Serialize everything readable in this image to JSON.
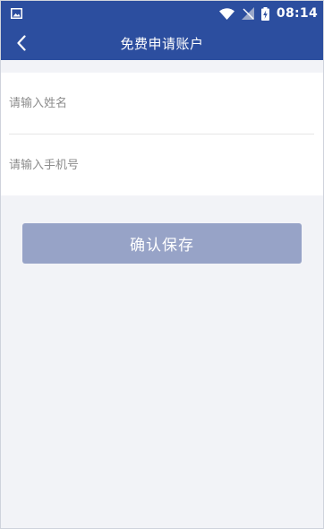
{
  "status_bar": {
    "time": "08:14",
    "icons": [
      "image-icon",
      "wifi-icon",
      "no-signal-icon",
      "battery-charging-icon"
    ]
  },
  "app_bar": {
    "back_icon": "chevron-left-icon",
    "title": "免费申请账户"
  },
  "form": {
    "name_placeholder": "请输入姓名",
    "name_value": "",
    "phone_placeholder": "请输入手机号",
    "phone_value": ""
  },
  "actions": {
    "confirm_label": "确认保存"
  },
  "colors": {
    "primary": "#2c4e9f",
    "button_disabled": "#97a3c7",
    "background": "#f2f3f7",
    "placeholder": "#8c8c8c"
  }
}
